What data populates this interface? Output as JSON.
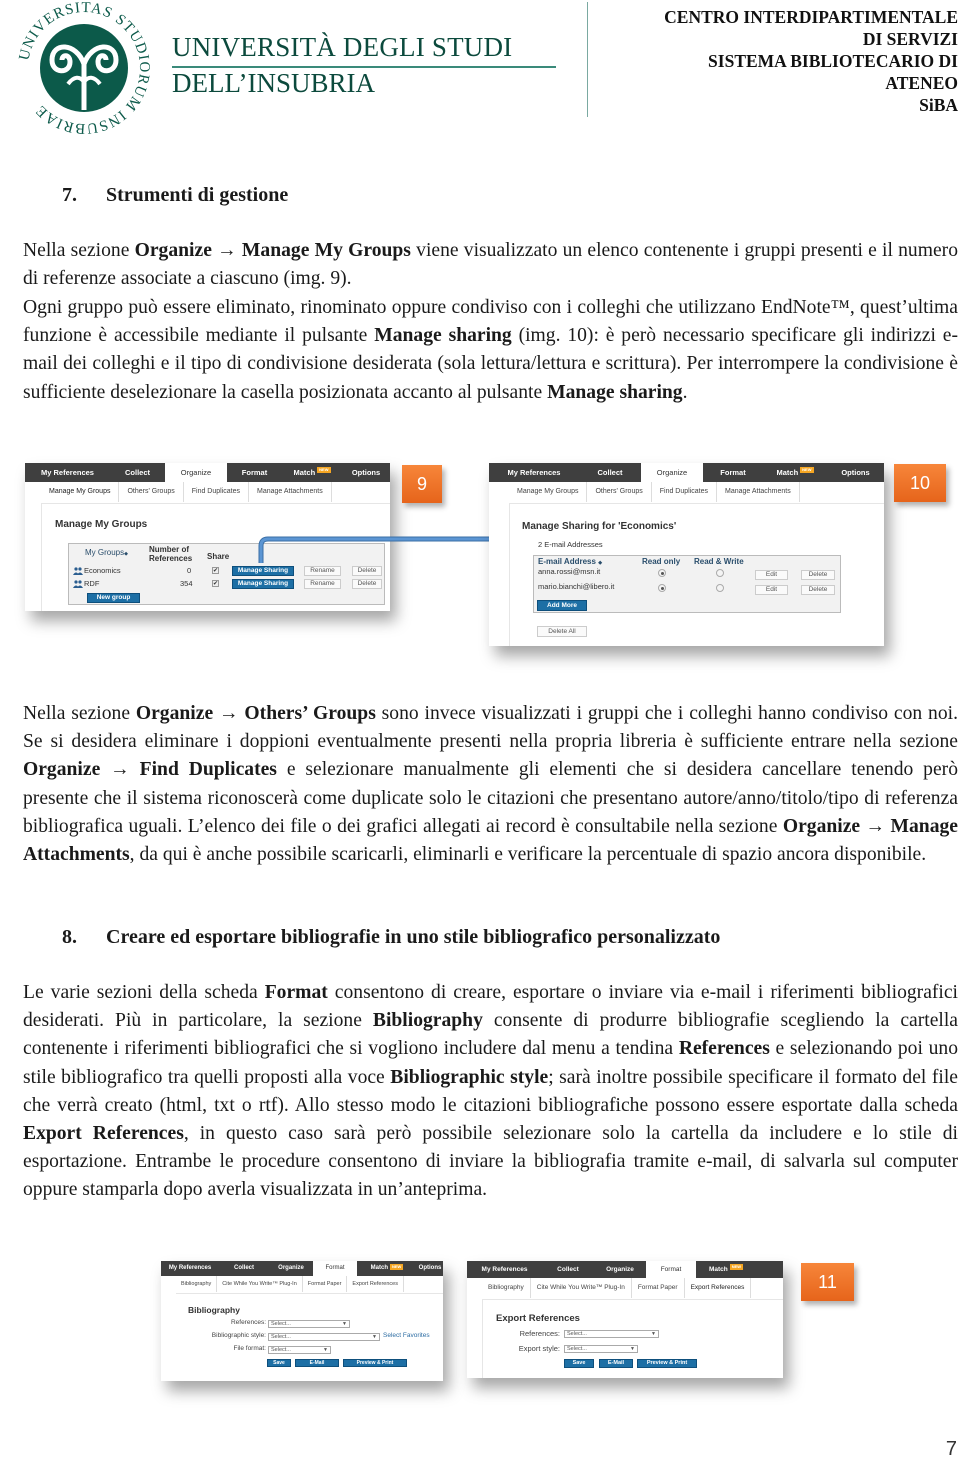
{
  "header": {
    "university_line1": "UNIVERSITÀ DEGLI STUDI",
    "university_line2": "DELL’INSUBRIA",
    "logo_motto": "UNIVERSITAS STUDIORUM INSUBRIAE",
    "centro_lines": [
      "CENTRO INTERDIPARTIMENTALE",
      "DI SERVIZI",
      "SISTEMA BIBLIOTECARIO DI",
      "ATENEO",
      "SiBA"
    ],
    "logo_color": "#0c5a4a"
  },
  "section7": {
    "number": "7.",
    "title": "Strumenti di gestione",
    "para1": [
      {
        "t": "Nella sezione "
      },
      {
        "b": "Organize → Manage My Groups"
      },
      {
        "t": " viene visualizzato un elenco contenente i gruppi presenti e il numero di referenze associate a ciascuno (img. 9)."
      }
    ],
    "para2": [
      {
        "t": "Ogni gruppo può essere eliminato, rinominato oppure condiviso con i colleghi che utilizzano EndNote™, quest’ultima funzione è accessibile mediante il pulsante "
      },
      {
        "b": "Manage sharing"
      },
      {
        "t": " (img. 10): è però necessario specificare gli indirizzi e-mail dei colleghi e il tipo di condivisione desiderata (sola lettura/lettura e scrittura). Per interrompere la condivisione è sufficiente deselezionare la casella posizionata accanto al pulsante "
      },
      {
        "b": "Manage sharing"
      },
      {
        "t": "."
      }
    ],
    "para3": [
      {
        "t": "Nella sezione "
      },
      {
        "b": "Organize → Others’ Groups"
      },
      {
        "t": " sono invece visualizzati i gruppi che i colleghi hanno condiviso con noi. Se si desidera eliminare i doppioni eventualmente presenti nella propria libreria è sufficiente entrare nella sezione "
      },
      {
        "b": "Organize → Find Duplicates"
      },
      {
        "t": " e selezionare manualmente gli elementi che si desidera cancellare tenendo però presente che il sistema riconoscerà come duplicate solo le citazioni che presentano autore/anno/titolo/tipo di referenza bibliografica uguali. L’elenco dei file o dei grafici allegati ai record è consultabile nella sezione "
      },
      {
        "b": "Organize → Manage Attachments"
      },
      {
        "t": ", da qui è anche possibile scaricarli, eliminarli e verificare la percentuale di spazio ancora disponibile."
      }
    ]
  },
  "section8": {
    "number": "8.",
    "title": "Creare ed esportare bibliografie in uno stile bibliografico personalizzato",
    "para1": [
      {
        "t": "Le varie sezioni della scheda "
      },
      {
        "b": "Format"
      },
      {
        "t": " consentono di creare, esportare o inviare via e-mail i riferimenti bibliografici desiderati. Più in particolare, la sezione "
      },
      {
        "b": "Bibliography"
      },
      {
        "t": " consente di produrre bibliografie scegliendo la cartella contenente i riferimenti bibliografici che si vogliono includere dal menu a tendina "
      },
      {
        "b": "References"
      },
      {
        "t": " e selezionando poi uno stile bibliografico tra quelli proposti alla voce "
      },
      {
        "b": "Bibliographic style"
      },
      {
        "t": "; sarà inoltre possibile specificare il formato del file che verrà creato (html, txt o rtf). Allo stesso modo le citazioni bibliografiche possono essere esportate dalla scheda "
      },
      {
        "b": "Export References"
      },
      {
        "t": ", in questo caso sarà però possibile selezionare solo la cartella da includere e lo stile di esportazione. Entrambe le procedure consentono di inviare la bibliografia tramite e-mail, di salvarla sul computer oppure stamparla dopo averla visualizzata in un’anteprima."
      }
    ]
  },
  "nav_tabs": [
    "My References",
    "Collect",
    "Organize",
    "Format",
    "Match",
    "Options"
  ],
  "new_badge": "NEW",
  "organize_subtabs": [
    "Manage My Groups",
    "Others' Groups",
    "Find Duplicates",
    "Manage Attachments"
  ],
  "format_subtabs": [
    "Bibliography",
    "Cite While You Write™ Plug-In",
    "Format Paper",
    "Export References"
  ],
  "img9": {
    "badge": "9",
    "title": "Manage My Groups",
    "col_groups": "My Groups",
    "col_number": "Number of",
    "col_number2": "References",
    "col_share": "Share",
    "rows": [
      {
        "name": "Economics",
        "count": "0",
        "shared": true,
        "share_btn": "Manage Sharing",
        "rename": "Rename",
        "delete": "Delete"
      },
      {
        "name": "RDF",
        "count": "354",
        "shared": true,
        "share_btn": "Manage Sharing",
        "rename": "Rename",
        "delete": "Delete"
      }
    ],
    "new_group": "New group",
    "sort_icon": "◆"
  },
  "img10": {
    "badge": "10",
    "title": "Manage Sharing for 'Economics'",
    "count_label": "2 E-mail Addresses",
    "col_email": "E-mail Address",
    "col_read": "Read only",
    "col_rw": "Read & Write",
    "rows": [
      {
        "email": "anna.rossi@msn.it",
        "read_only": true,
        "edit": "Edit",
        "delete": "Delete"
      },
      {
        "email": "mario.bianchi@libero.it",
        "read_only": true,
        "edit": "Edit",
        "delete": "Delete"
      }
    ],
    "add_more": "Add More",
    "delete_all": "Delete All"
  },
  "img11a": {
    "title": "Bibliography",
    "references_label": "References:",
    "style_label": "Bibliographic style:",
    "format_label": "File format:",
    "select_placeholder": "Select...",
    "select_favorites": "Select Favorites",
    "save": "Save",
    "email": "E-Mail",
    "preview": "Preview & Print"
  },
  "img11b": {
    "badge": "11",
    "title": "Export References",
    "references_label": "References:",
    "style_label": "Export style:",
    "select_placeholder": "Select...",
    "save": "Save",
    "email": "E-Mail",
    "preview": "Preview & Print"
  },
  "page_number": "7",
  "colors": {
    "accent_orange": "#ed7025",
    "nav_dark": "#3f3f3f",
    "button_blue": "#1d6fa5",
    "arrow_blue": "#4a86c5",
    "logo_green": "#0c5a4a"
  }
}
